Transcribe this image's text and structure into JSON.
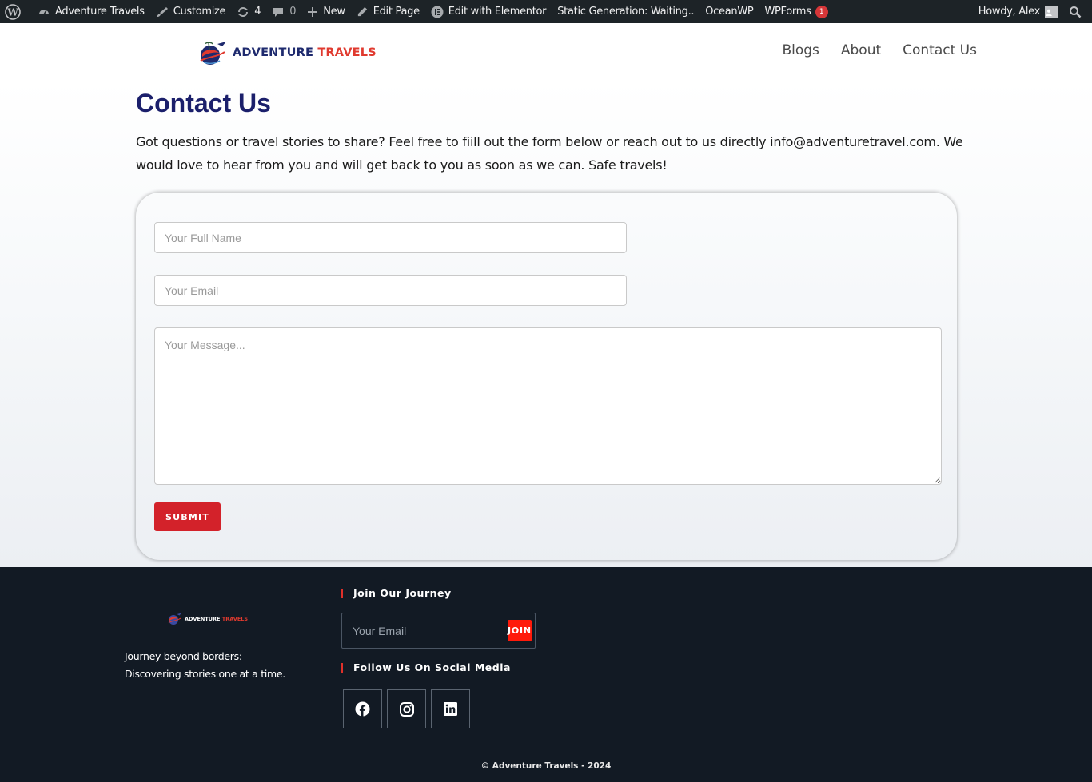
{
  "admin_bar": {
    "site_name": "Adventure Travels",
    "customize": "Customize",
    "updates_count": "4",
    "comments_count": "0",
    "new": "New",
    "edit_page": "Edit Page",
    "edit_elementor": "Edit with Elementor",
    "static_generation": "Static Generation: Waiting..",
    "oceanwp": "OceanWP",
    "wpforms": "WPForms",
    "wpforms_badge": "1",
    "howdy": "Howdy, Alex"
  },
  "header": {
    "logo_word1": "ADVENTURE",
    "logo_word2": "TRAVELS",
    "nav": [
      "Blogs",
      "About",
      "Contact Us"
    ]
  },
  "main": {
    "title": "Contact Us",
    "intro": "Got questions or travel stories to share? Feel free to fiill out the form below or reach out to us directly info@adventuretravel.com. We would love to hear from you and will get back to you as soon as we can. Safe travels!",
    "form": {
      "name_placeholder": "Your Full Name",
      "email_placeholder": "Your Email",
      "message_placeholder": "Your Message...",
      "submit_label": "SUBMIT"
    }
  },
  "footer": {
    "logo_word1": "ADVENTURE",
    "logo_word2": "TRAVELS",
    "tagline_line1": "Journey beyond borders:",
    "tagline_line2": "Discovering stories one at a time.",
    "join_heading": "Join Our Journey",
    "newsletter_placeholder": "Your Email",
    "join_label": "JOIN",
    "social_heading": "Follow Us On Social Media",
    "social_icons": [
      "facebook-icon",
      "instagram-icon",
      "linkedin-icon"
    ],
    "copyright": "© Adventure Travels - 2024"
  },
  "colors": {
    "admin_bar_bg": "#1d2327",
    "title_navy": "#1b1f6b",
    "submit_red": "#d3222a",
    "join_red": "#ff1a0a",
    "footer_bg": "#121a24"
  }
}
